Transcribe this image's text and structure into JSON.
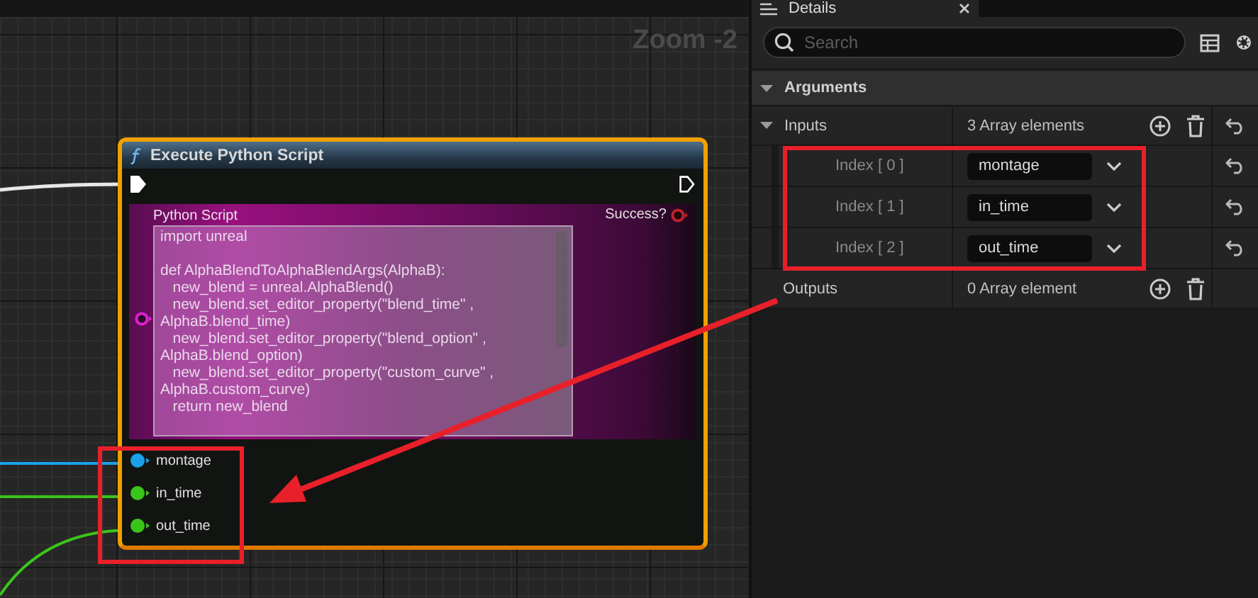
{
  "graph": {
    "zoom_label": "Zoom -2",
    "node": {
      "title": "Execute Python Script",
      "script_label": "Python Script",
      "output_label": "Success?",
      "script_blocks": [
        [
          "import unreal"
        ],
        [
          "def AlphaBlendToAlphaBlendArgs(AlphaB):",
          "   new_blend = unreal.AlphaBlend()",
          "   new_blend.set_editor_property(\"blend_time\" ,",
          "AlphaB.blend_time)",
          "   new_blend.set_editor_property(\"blend_option\" ,",
          "AlphaB.blend_option)",
          "   new_blend.set_editor_property(\"custom_curve\" ,",
          "AlphaB.custom_curve)",
          "   return new_blend"
        ]
      ],
      "pins": [
        {
          "name": "montage",
          "color": "#1aa0e8"
        },
        {
          "name": "in_time",
          "color": "#3bc41a"
        },
        {
          "name": "out_time",
          "color": "#3bc41a"
        }
      ]
    }
  },
  "details": {
    "tab_title": "Details",
    "search": {
      "placeholder": "Search"
    },
    "section": {
      "title": "Arguments",
      "expanded": true
    },
    "inputs": {
      "label": "Inputs",
      "expanded": true,
      "summary": "3 Array elements",
      "elements": [
        {
          "label": "Index [ 0 ]",
          "value": "montage"
        },
        {
          "label": "Index [ 1 ]",
          "value": "in_time"
        },
        {
          "label": "Index [ 2 ]",
          "value": "out_time"
        }
      ]
    },
    "outputs": {
      "label": "Outputs",
      "summary": "0 Array element"
    }
  }
}
